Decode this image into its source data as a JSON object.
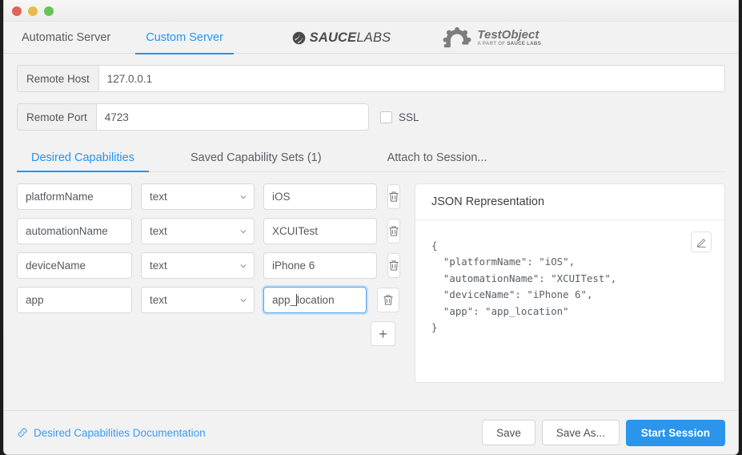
{
  "window": {
    "traffic_lights": [
      "close",
      "minimize",
      "maximize"
    ]
  },
  "server_tabs": [
    {
      "label": "Automatic Server",
      "active": false
    },
    {
      "label": "Custom Server",
      "active": true
    }
  ],
  "logos": {
    "sauce": {
      "bold": "SAUCE",
      "light": "LABS",
      "icon": "saucelabs-logo-icon"
    },
    "testobject": {
      "title": "TestObject",
      "sub_prefix": "A PART OF ",
      "sub_brand": "SAUCE LABS",
      "icon": "testobject-logo-icon"
    }
  },
  "server_form": {
    "host": {
      "label": "Remote Host",
      "value": "127.0.0.1",
      "placeholder": "Remote Host"
    },
    "port": {
      "label": "Remote Port",
      "value": "4723",
      "placeholder": "Remote Port"
    },
    "ssl": {
      "label": "SSL",
      "checked": false
    }
  },
  "cap_tabs": [
    {
      "label": "Desired Capabilities",
      "active": true
    },
    {
      "label": "Saved Capability Sets (1)",
      "active": false
    },
    {
      "label": "Attach to Session...",
      "active": false
    }
  ],
  "capabilities": [
    {
      "name": "platformName",
      "type": "text",
      "value": "iOS",
      "focused": false
    },
    {
      "name": "automationName",
      "type": "text",
      "value": "XCUITest",
      "focused": false
    },
    {
      "name": "deviceName",
      "type": "text",
      "value": "iPhone 6",
      "focused": false
    },
    {
      "name": "app",
      "type": "text",
      "value": "app_location",
      "focused": true,
      "caret_after": "app_"
    }
  ],
  "cap_value_caret": {
    "before": "app_",
    "after": "location"
  },
  "add_button": {
    "label": "+"
  },
  "json_panel": {
    "title": "JSON Representation",
    "content": "{\n  \"platformName\": \"iOS\",\n  \"automationName\": \"XCUITest\",\n  \"deviceName\": \"iPhone 6\",\n  \"app\": \"app_location\"\n}",
    "edit_icon": "pencil-icon"
  },
  "footer": {
    "doc_link": "Desired Capabilities Documentation",
    "save": "Save",
    "save_as": "Save As...",
    "start_session": "Start Session"
  },
  "colors": {
    "accent_blue": "#2196f3",
    "primary_button": "#2b95ec",
    "focus_border": "#4ea6f5",
    "window_bg": "#f2f2f2",
    "desktop": "#1b1b1b"
  }
}
